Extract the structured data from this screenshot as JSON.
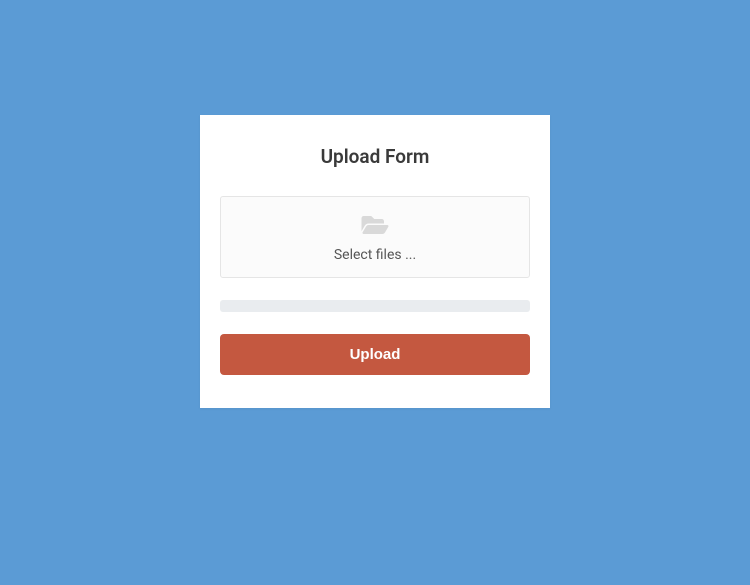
{
  "form": {
    "title": "Upload Form",
    "select_label": "Select files ...",
    "upload_button": "Upload"
  }
}
